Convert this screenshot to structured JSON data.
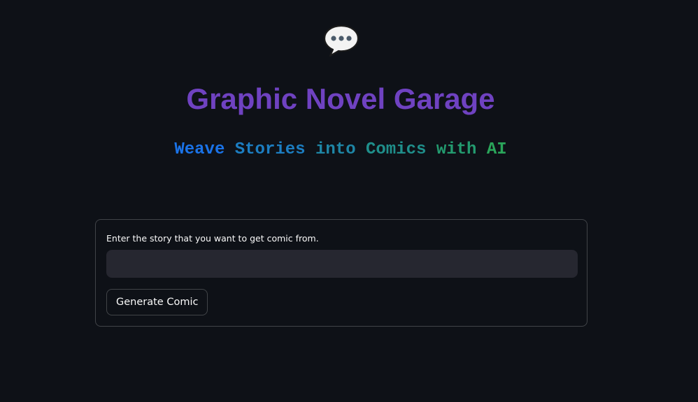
{
  "header": {
    "icon": "speech-bubble-icon",
    "title": "Graphic Novel Garage",
    "subtitle_words": [
      {
        "text": "Weave",
        "color": "#1a73e8"
      },
      {
        "text": "Stories",
        "color": "#1c7ec2"
      },
      {
        "text": "into",
        "color": "#1e86a6"
      },
      {
        "text": "Comics",
        "color": "#1f8f8b"
      },
      {
        "text": "with",
        "color": "#239b6f"
      },
      {
        "text": "AI",
        "color": "#2aa55a"
      }
    ]
  },
  "form": {
    "label": "Enter the story that you want to get comic from.",
    "input_value": "",
    "input_placeholder": "",
    "button_label": "Generate Comic"
  },
  "colors": {
    "background": "#0e1117",
    "title": "#6f42c1",
    "input_bg": "#262730"
  }
}
